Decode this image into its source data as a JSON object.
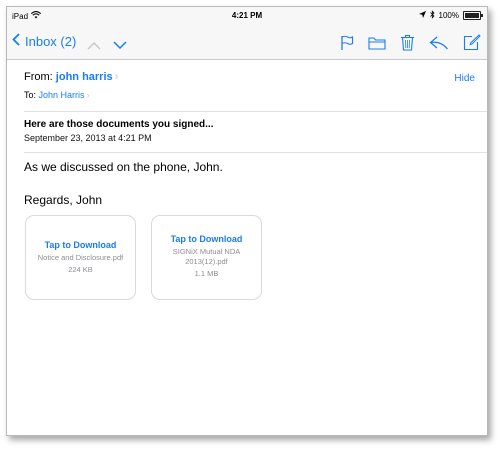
{
  "status_bar": {
    "device": "iPad",
    "time": "4:21 PM",
    "battery": "100%"
  },
  "nav": {
    "back_label": "Inbox (2)"
  },
  "message": {
    "from_label": "From:",
    "from_name": "john harris",
    "to_label": "To:",
    "to_name": "John Harris",
    "hide_label": "Hide",
    "subject": "Here are those documents you signed...",
    "date": "September 23, 2013 at 4:21 PM",
    "body_lines": [
      "As we discussed on the phone, John.",
      "Regards, John"
    ]
  },
  "attachments": [
    {
      "action": "Tap to Download",
      "filename": "Notice and Disclosure.pdf",
      "size": "224 KB"
    },
    {
      "action": "Tap to Download",
      "filename": "SIGNiX Mutual NDA 2013(12).pdf",
      "size": "1.1 MB"
    }
  ],
  "colors": {
    "accent": "#1a7cf4",
    "chrome": "#f7f7f7",
    "secondary_text": "#8e8e93"
  }
}
